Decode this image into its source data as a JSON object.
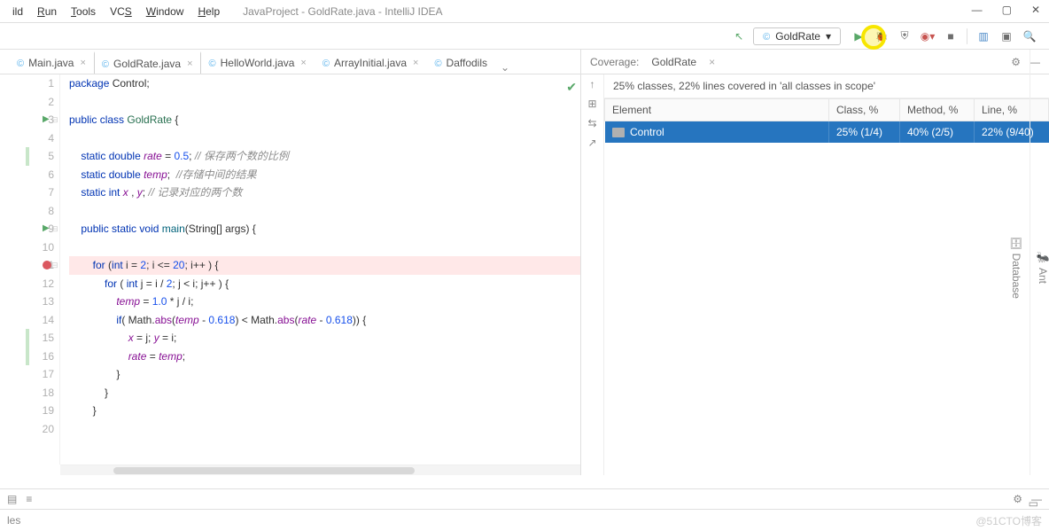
{
  "menu": {
    "items": [
      "ild",
      "Run",
      "Tools",
      "VCS",
      "Window",
      "Help"
    ]
  },
  "title": "JavaProject - GoldRate.java - IntelliJ IDEA",
  "winctrls": [
    "—",
    "▢",
    "✕"
  ],
  "runconfig": {
    "name": "GoldRate"
  },
  "tabs": [
    {
      "label": "Main.java",
      "active": false
    },
    {
      "label": "GoldRate.java",
      "active": true
    },
    {
      "label": "HelloWorld.java",
      "active": false
    },
    {
      "label": "ArrayInitial.java",
      "active": false
    },
    {
      "label": "Daffodils",
      "active": false
    }
  ],
  "gutter": [
    {
      "n": 1
    },
    {
      "n": 2
    },
    {
      "n": 3,
      "run": true,
      "fold": true
    },
    {
      "n": 4
    },
    {
      "n": 5,
      "grn": true
    },
    {
      "n": 6
    },
    {
      "n": 7
    },
    {
      "n": 8
    },
    {
      "n": 9,
      "run": true,
      "fold": true
    },
    {
      "n": 10
    },
    {
      "n": 11,
      "bp": true,
      "fold": true
    },
    {
      "n": 12
    },
    {
      "n": 13
    },
    {
      "n": 14
    },
    {
      "n": 15,
      "grn": true
    },
    {
      "n": 16,
      "grn": true
    },
    {
      "n": 17
    },
    {
      "n": 18
    },
    {
      "n": 19
    },
    {
      "n": 20
    }
  ],
  "code": [
    {
      "h": "<span class=kw>package</span> Control;"
    },
    {
      "h": ""
    },
    {
      "h": "<span class=kw>public class</span> <span class=str-cls>GoldRate</span> {"
    },
    {
      "h": ""
    },
    {
      "h": "    <span class=kw>static</span> <span class=type>double</span> <span class=fld>rate</span> = <span class=num>0.5</span>; <span class=com>// 保存两个数的比例</span>"
    },
    {
      "h": "    <span class=kw>static</span> <span class=type>double</span> <span class=fld>temp</span>;  <span class=com>//存储中间的结果</span>"
    },
    {
      "h": "    <span class=kw>static</span> <span class=type>int</span> <span class=fld>x</span> , <span class=fld>y</span>; <span class=com>// 记录对应的两个数</span>"
    },
    {
      "h": ""
    },
    {
      "h": "    <span class=kw>public static</span> <span class=type>void</span> <span class=mth>main</span>(String[] args) {"
    },
    {
      "h": ""
    },
    {
      "h": "        <span class=kw>for</span> (<span class=type>int</span> i = <span class=num>2</span>; i &lt;= <span class=num>20</span>; i++ ) {",
      "bp": true
    },
    {
      "h": "            <span class=kw>for</span> ( <span class=type>int</span> j = i / <span class=num>2</span>; j &lt; i; j++ ) {"
    },
    {
      "h": "                <span class=fld>temp</span> = <span class=num>1.0</span> * j / i;"
    },
    {
      "h": "                <span class=kw>if</span>( Math.<span class=fn>abs</span>(<span class=fld>temp</span> - <span class=num>0.618</span>) &lt; Math.<span class=fn>abs</span>(<span class=fld>rate</span> - <span class=num>0.618</span>)) {"
    },
    {
      "h": "                    <span class=fld>x</span> = j; <span class=fld>y</span> = i;"
    },
    {
      "h": "                    <span class=fld>rate</span> = <span class=fld>temp</span>;"
    },
    {
      "h": "                }"
    },
    {
      "h": "            }"
    },
    {
      "h": "        }"
    },
    {
      "h": ""
    }
  ],
  "coverage": {
    "title": "Coverage:",
    "run": "GoldRate",
    "summary": "25% classes, 22% lines covered in 'all classes in scope'",
    "cols": [
      "Element",
      "Class, %",
      "Method, %",
      "Line, %"
    ],
    "rows": [
      {
        "el": "Control",
        "cls": "25% (1/4)",
        "mth": "40% (2/5)",
        "ln": "22% (9/40)"
      }
    ]
  },
  "rightRail": [
    "Ant",
    "Database"
  ],
  "statusbar": {
    "left": "les",
    "wm": "@51CTO博客"
  }
}
